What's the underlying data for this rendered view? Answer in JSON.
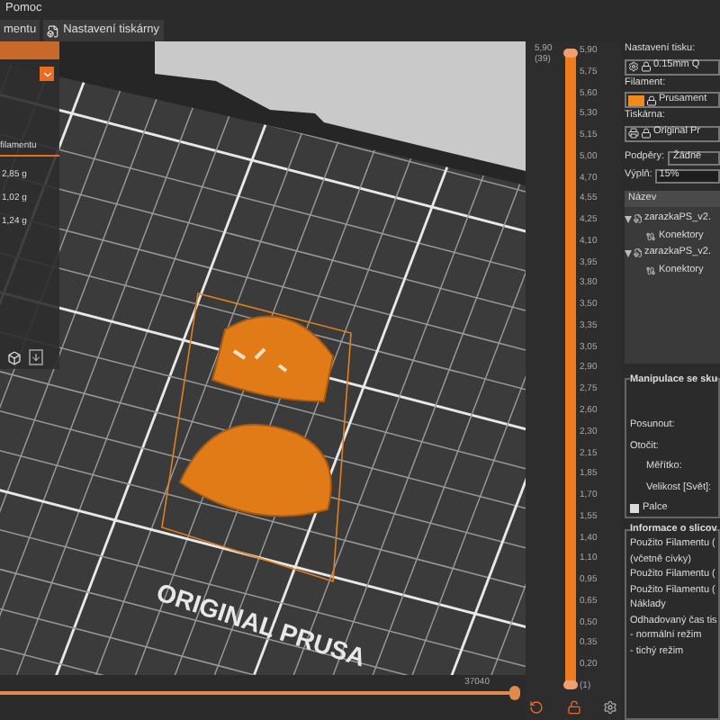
{
  "menu": [
    "Pomoc"
  ],
  "tabs": [
    {
      "label": "mentu",
      "selected": false
    },
    {
      "label": "Nastavení tiskárny",
      "selected": false
    }
  ],
  "left_panel": {
    "heading": "filamentu",
    "values": [
      "2,85 g",
      "1,02 g",
      "1,24 g"
    ]
  },
  "bed_label": "ORIGINAL PRUSA",
  "horizontal_slider": {
    "reading": "37040",
    "level": 1
  },
  "vertical_slider": {
    "top_label": "5,90",
    "top_layer": "(39)",
    "bottom_layer": "(1)",
    "handles": [
      {
        "level": 1
      },
      {
        "level": 0
      }
    ],
    "ticks": [
      "5,90",
      "5,75",
      "5,60",
      "5,30",
      "5,15",
      "5,00",
      "4,70",
      "4,55",
      "4,25",
      "4,10",
      "3,95",
      "3,80",
      "3,50",
      "3,35",
      "3,05",
      "2,90",
      "2,75",
      "2,60",
      "2,30",
      "2,15",
      "1,85",
      "1,70",
      "1,55",
      "1,40",
      "1,10",
      "0,95",
      "0,65",
      "0,50",
      "0,35",
      "0,20"
    ]
  },
  "right_panel": {
    "print_label": "Nastavení tisku:",
    "print_value": "0.15mm Q",
    "filament_label": "Filament:",
    "filament_value": "Prusament",
    "printer_label": "Tiskárna:",
    "printer_value": "Original Pr",
    "supports_label": "Podpěry:",
    "supports_value": "Žádné",
    "infill_label": "Výplň:",
    "infill_value": "15%",
    "list_header": "Název",
    "objects": [
      {
        "name": "zarazkaPS_v2.",
        "expanded": true,
        "children": [
          {
            "name": "Konektory"
          }
        ]
      },
      {
        "name": "zarazkaPS_v2.",
        "expanded": true,
        "children": [
          {
            "name": "Konektory"
          }
        ]
      }
    ],
    "manipulation": {
      "title": "Manipulace se sku",
      "rows": [
        "Posunout:",
        "Otočit:",
        "Měřítko:",
        "Velikost [Svět]:"
      ],
      "inches_label": "Palce",
      "inches_checked": false
    },
    "info": {
      "title": "Informace o slicov",
      "lines": [
        "Použito Filamentu (",
        "(včetně cívky)",
        "Použito Filamentu (",
        "Použito Filamentu (",
        "Náklady",
        "Odhadovaný čas tis",
        "- normální režim",
        "- tichý režim"
      ]
    }
  }
}
